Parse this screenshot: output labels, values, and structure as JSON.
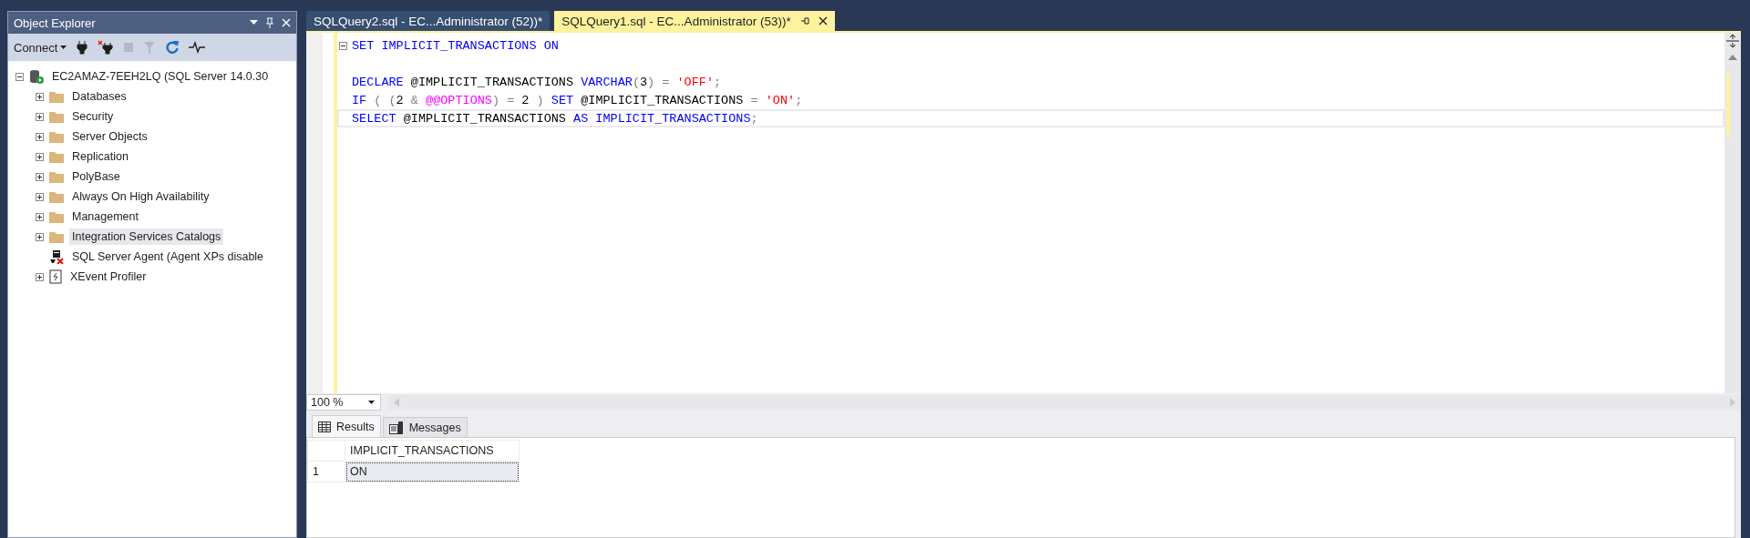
{
  "object_explorer": {
    "title": "Object Explorer",
    "toolbar": {
      "connect_label": "Connect",
      "buttons": [
        {
          "kind": "plug",
          "disabled": false
        },
        {
          "kind": "unplug",
          "disabled": false
        },
        {
          "kind": "stop",
          "disabled": true
        },
        {
          "kind": "filter",
          "disabled": true
        },
        {
          "kind": "refresh",
          "disabled": false
        },
        {
          "kind": "pulse",
          "disabled": false
        }
      ]
    },
    "server": {
      "label": "EC2AMAZ-7EEH2LQ (SQL Server 14.0.30",
      "expanded": true,
      "children": [
        {
          "label": "Databases",
          "kind": "folder",
          "expandable": true,
          "selected": false
        },
        {
          "label": "Security",
          "kind": "folder",
          "expandable": true,
          "selected": false
        },
        {
          "label": "Server Objects",
          "kind": "folder",
          "expandable": true,
          "selected": false
        },
        {
          "label": "Replication",
          "kind": "folder",
          "expandable": true,
          "selected": false
        },
        {
          "label": "PolyBase",
          "kind": "folder",
          "expandable": true,
          "selected": false
        },
        {
          "label": "Always On High Availability",
          "kind": "folder",
          "expandable": true,
          "selected": false
        },
        {
          "label": "Management",
          "kind": "folder",
          "expandable": true,
          "selected": false
        },
        {
          "label": "Integration Services Catalogs",
          "kind": "folder",
          "expandable": true,
          "selected": true
        },
        {
          "label": "SQL Server Agent (Agent XPs disable",
          "kind": "agent",
          "expandable": false,
          "selected": false
        },
        {
          "label": "XEvent Profiler",
          "kind": "profiler",
          "expandable": true,
          "selected": false
        }
      ]
    }
  },
  "editor": {
    "tabs": [
      {
        "title": "SQLQuery2.sql - EC...Administrator (52))*",
        "selected": false
      },
      {
        "title": "SQLQuery1.sql - EC...Administrator (53))*",
        "selected": true
      }
    ],
    "lines": [
      {
        "foldable": true,
        "current": false,
        "tokens": [
          {
            "text": "SET IMPLICIT_TRANSACTIONS ON",
            "kind": "keyword"
          }
        ]
      },
      {
        "foldable": false,
        "current": false
      },
      {
        "foldable": false,
        "current": false,
        "tokens": [
          {
            "text": "DECLARE",
            "kind": "keyword"
          },
          {
            "text": " @IMPLICIT_TRANSACTIONS ",
            "kind": "plain"
          },
          {
            "text": "VARCHAR",
            "kind": "keyword"
          },
          {
            "text": "(",
            "kind": "operator"
          },
          {
            "text": "3",
            "kind": "plain"
          },
          {
            "text": ") = ",
            "kind": "operator"
          },
          {
            "text": "'OFF'",
            "kind": "string"
          },
          {
            "text": ";",
            "kind": "operator"
          }
        ]
      },
      {
        "foldable": false,
        "current": false,
        "tokens": [
          {
            "text": "IF",
            "kind": "keyword"
          },
          {
            "text": " ( (",
            "kind": "operator"
          },
          {
            "text": "2",
            "kind": "plain"
          },
          {
            "text": " & ",
            "kind": "operator"
          },
          {
            "text": "@@OPTIONS",
            "kind": "system"
          },
          {
            "text": ") = ",
            "kind": "operator"
          },
          {
            "text": "2",
            "kind": "plain"
          },
          {
            "text": " ) ",
            "kind": "operator"
          },
          {
            "text": "SET",
            "kind": "keyword"
          },
          {
            "text": " @IMPLICIT_TRANSACTIONS",
            "kind": "plain"
          },
          {
            "text": " = ",
            "kind": "operator"
          },
          {
            "text": "'ON'",
            "kind": "string"
          },
          {
            "text": ";",
            "kind": "operator"
          }
        ]
      },
      {
        "foldable": false,
        "current": true,
        "tokens": [
          {
            "text": "SELECT",
            "kind": "keyword"
          },
          {
            "text": " @IMPLICIT_TRANSACTIONS ",
            "kind": "plain"
          },
          {
            "text": "AS IMPLICIT_TRANSACTIONS",
            "kind": "keyword"
          },
          {
            "text": ";",
            "kind": "operator"
          }
        ]
      }
    ],
    "zoom": "100 %"
  },
  "results": {
    "tabs": [
      {
        "label": "Results",
        "kind": "grid",
        "selected": true
      },
      {
        "label": "Messages",
        "kind": "messages",
        "selected": false
      }
    ],
    "columns": [
      "IMPLICIT_TRANSACTIONS"
    ],
    "rows": [
      {
        "number": "1",
        "cells": [
          {
            "text": "ON",
            "selected": true
          }
        ]
      }
    ]
  }
}
